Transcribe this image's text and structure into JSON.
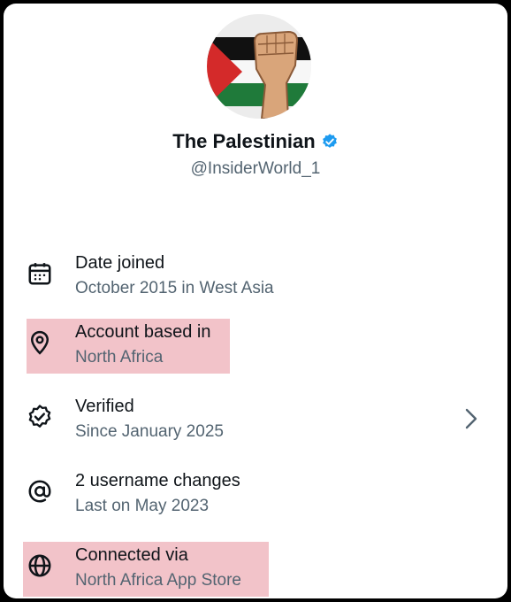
{
  "profile": {
    "name": "The Palestinian",
    "handle": "@InsiderWorld_1",
    "verified_badge_color": "#1d9bf0"
  },
  "about": [
    {
      "title": "Date joined",
      "subtitle": "October 2015 in West Asia",
      "icon": "calendar-icon",
      "highlighted": false
    },
    {
      "title": "Account based in",
      "subtitle": "North Africa",
      "icon": "location-pin-icon",
      "highlighted": true
    },
    {
      "title": "Verified",
      "subtitle": "Since January 2025",
      "icon": "verified-badge-icon",
      "highlighted": false,
      "has_chevron": true
    },
    {
      "title": "2 username changes",
      "subtitle": "Last on May 2023",
      "icon": "at-sign-icon",
      "highlighted": false
    },
    {
      "title": "Connected via",
      "subtitle": "North Africa App Store",
      "icon": "globe-icon",
      "highlighted": true
    }
  ],
  "colors": {
    "text_primary": "#0f1419",
    "text_secondary": "#536471",
    "highlight": "#f2c3c9"
  }
}
